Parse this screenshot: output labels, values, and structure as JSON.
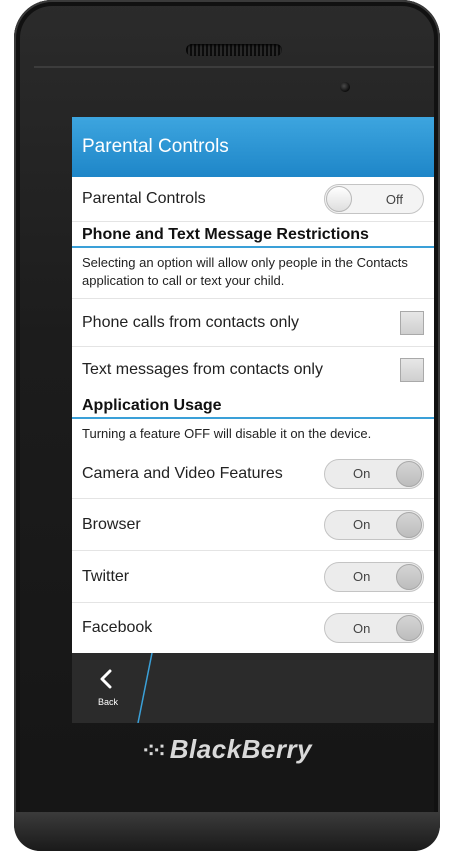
{
  "brand": {
    "name": "BlackBerry",
    "logo_glyph": "⁖⁖"
  },
  "screen": {
    "title": "Parental Controls",
    "master": {
      "label": "Parental Controls",
      "state": "Off"
    },
    "phone_section": {
      "heading": "Phone and Text Message Restrictions",
      "note": "Selecting an option will allow only people in the Contacts application to call or text your child.",
      "items": [
        {
          "label": "Phone calls from contacts only",
          "checked": false
        },
        {
          "label": "Text messages from contacts only",
          "checked": false
        }
      ]
    },
    "app_section": {
      "heading": "Application Usage",
      "note": "Turning a feature OFF will disable it on the device.",
      "items": [
        {
          "label": "Camera and Video Features",
          "state": "On"
        },
        {
          "label": "Browser",
          "state": "On"
        },
        {
          "label": "Twitter",
          "state": "On"
        },
        {
          "label": "Facebook",
          "state": "On"
        }
      ]
    },
    "action_bar": {
      "back_label": "Back"
    }
  },
  "colors": {
    "title_bar": "#1e86c8",
    "accent_line": "#3aa0d8",
    "action_bar": "#2b2b2b"
  }
}
